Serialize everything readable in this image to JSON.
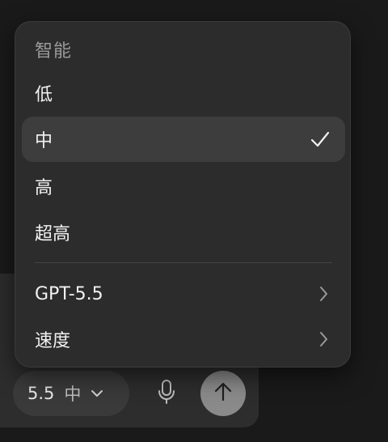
{
  "menu": {
    "header": "智能",
    "reasoning_levels": [
      {
        "label": "低",
        "selected": false
      },
      {
        "label": "中",
        "selected": true
      },
      {
        "label": "高",
        "selected": false
      },
      {
        "label": "超高",
        "selected": false
      }
    ],
    "submenus": [
      {
        "label": "GPT-5.5"
      },
      {
        "label": "速度"
      }
    ]
  },
  "composer": {
    "model_version": "5.5",
    "reasoning_level": "中"
  },
  "icons": {
    "selected": "checkmark-icon",
    "submenu": "chevron-right-icon",
    "dropdown": "chevron-down-icon",
    "mic": "microphone-icon",
    "send": "arrow-up-icon"
  },
  "colors": {
    "background": "#1a1a1a",
    "menu_bg": "#2c2c2c",
    "selected_row": "#3d3d3d",
    "send_button": "#8a8a8a"
  }
}
